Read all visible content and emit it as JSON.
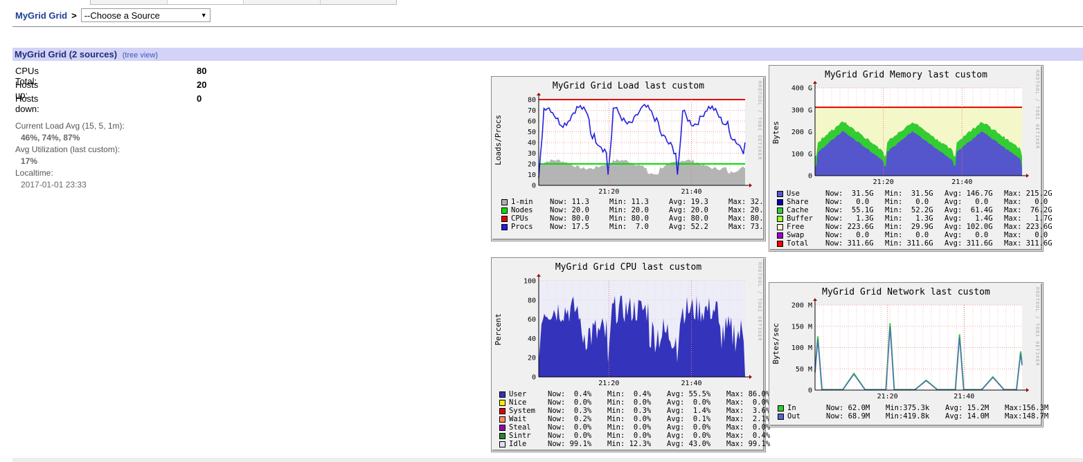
{
  "breadcrumb": {
    "grid_link": "MyGrid Grid",
    "separator": ">",
    "source_select": "--Choose a Source"
  },
  "section": {
    "title": "MyGrid Grid (2 sources)",
    "tree_link": "(tree view)"
  },
  "summary": {
    "cpus_label": "CPUs Total:",
    "cpus_value": "80",
    "hosts_up_label": "Hosts up:",
    "hosts_up_value": "20",
    "hosts_down_label": "Hosts down:",
    "hosts_down_value": "0"
  },
  "metrics": {
    "load_label": "Current Load Avg (15, 5, 1m):",
    "load_value": "46%, 74%, 87%",
    "util_label": "Avg Utilization (last custom):",
    "util_value": "17%",
    "localtime_label": "Localtime:",
    "localtime_value": "2017-01-01 23:33"
  },
  "graphs": {
    "load": {
      "title": "MyGrid Grid Load last custom",
      "ylabel": "Loads/Procs",
      "watermark": "RRDTOOL / TOBI OETIKER",
      "yticks": [
        "80",
        "70",
        "60",
        "50",
        "40",
        "30",
        "20",
        "10",
        "0"
      ],
      "xticks": [
        "21:20",
        "21:40"
      ],
      "legend": [
        {
          "color": "#b0b0b0",
          "name": "1-min",
          "now": "Now: 11.3",
          "min": "Min: 11.3",
          "avg": "Avg: 19.3",
          "max": "Max: 32."
        },
        {
          "color": "#00e000",
          "name": "Nodes",
          "now": "Now: 20.0",
          "min": "Min: 20.0",
          "avg": "Avg: 20.0",
          "max": "Max: 20."
        },
        {
          "color": "#e00000",
          "name": "CPUs",
          "now": "Now: 80.0",
          "min": "Min: 80.0",
          "avg": "Avg: 80.0",
          "max": "Max: 80."
        },
        {
          "color": "#2020e0",
          "name": "Procs",
          "now": "Now: 17.5",
          "min": "Min:  7.0",
          "avg": "Avg: 52.2",
          "max": "Max: 73."
        }
      ]
    },
    "memory": {
      "title": "MyGrid Grid Memory last custom",
      "ylabel": "Bytes",
      "watermark": "RRDTOOL / TOBI OETIKER",
      "yticks": [
        "400 G",
        "300 G",
        "200 G",
        "100 G",
        "0"
      ],
      "xticks": [
        "21:20",
        "21:40"
      ],
      "legend": [
        {
          "color": "#5555cc",
          "name": "Use",
          "now": "Now:  31.5G",
          "min": "Min:  31.5G",
          "avg": "Avg: 146.7G",
          "max": "Max: 215.2G"
        },
        {
          "color": "#0000aa",
          "name": "Share",
          "now": "Now:   0.0",
          "min": "Min:   0.0",
          "avg": "Avg:   0.0",
          "max": "Max:   0.0"
        },
        {
          "color": "#33cc33",
          "name": "Cache",
          "now": "Now:  55.1G",
          "min": "Min:  52.2G",
          "avg": "Avg:  61.4G",
          "max": "Max:  76.2G"
        },
        {
          "color": "#99ff33",
          "name": "Buffer",
          "now": "Now:   1.3G",
          "min": "Min:   1.3G",
          "avg": "Avg:   1.4G",
          "max": "Max:   1.7G"
        },
        {
          "color": "#ffffcc",
          "name": "Free",
          "now": "Now: 223.6G",
          "min": "Min:  29.9G",
          "avg": "Avg: 102.0G",
          "max": "Max: 223.6G"
        },
        {
          "color": "#9900cc",
          "name": "Swap",
          "now": "Now:   0.0",
          "min": "Min:   0.0",
          "avg": "Avg:   0.0",
          "max": "Max:   0.0"
        },
        {
          "color": "#ff0000",
          "name": "Total",
          "now": "Now: 311.6G",
          "min": "Min: 311.6G",
          "avg": "Avg: 311.6G",
          "max": "Max: 311.6G"
        }
      ]
    },
    "cpu": {
      "title": "MyGrid Grid CPU last custom",
      "ylabel": "Percent",
      "watermark": "RRDTOOL / TOBI OETIKER",
      "yticks": [
        "100",
        "80",
        "60",
        "40",
        "20",
        "0"
      ],
      "xticks": [
        "21:20",
        "21:40"
      ],
      "legend": [
        {
          "color": "#3333bb",
          "name": "User",
          "now": "Now:  0.4%",
          "min": "Min:  0.4%",
          "avg": "Avg: 55.5%",
          "max": "Max: 86.0%"
        },
        {
          "color": "#ffea00",
          "name": "Nice",
          "now": "Now:  0.0%",
          "min": "Min:  0.0%",
          "avg": "Avg:  0.0%",
          "max": "Max:  0.0%"
        },
        {
          "color": "#dd0000",
          "name": "System",
          "now": "Now:  0.3%",
          "min": "Min:  0.3%",
          "avg": "Avg:  1.4%",
          "max": "Max:  3.6%"
        },
        {
          "color": "#ff8a60",
          "name": "Wait",
          "now": "Now:  0.2%",
          "min": "Min:  0.0%",
          "avg": "Avg:  0.1%",
          "max": "Max:  2.1%"
        },
        {
          "color": "#9900aa",
          "name": "Steal",
          "now": "Now:  0.0%",
          "min": "Min:  0.0%",
          "avg": "Avg:  0.0%",
          "max": "Max:  0.0%"
        },
        {
          "color": "#228833",
          "name": "Sintr",
          "now": "Now:  0.0%",
          "min": "Min:  0.0%",
          "avg": "Avg:  0.0%",
          "max": "Max:  0.4%"
        },
        {
          "color": "#e2e2f2",
          "name": "Idle",
          "now": "Now: 99.1%",
          "min": "Min: 12.3%",
          "avg": "Avg: 43.0%",
          "max": "Max: 99.1%"
        }
      ]
    },
    "network": {
      "title": "MyGrid Grid Network last custom",
      "ylabel": "Bytes/sec",
      "watermark": "RRDTOOL / TOBI OETIKER",
      "yticks": [
        "200 M",
        "150 M",
        "100 M",
        "50 M",
        "0"
      ],
      "xticks": [
        "21:20",
        "21:40"
      ],
      "legend": [
        {
          "color": "#33cc33",
          "name": "In",
          "now": "Now: 62.0M",
          "min": "Min:375.3k",
          "avg": "Avg: 15.2M",
          "max": "Max:156.3M"
        },
        {
          "color": "#5566cc",
          "name": "Out",
          "now": "Now: 68.9M",
          "min": "Min:419.8k",
          "avg": "Avg: 14.0M",
          "max": "Max:148.7M"
        }
      ]
    }
  }
}
